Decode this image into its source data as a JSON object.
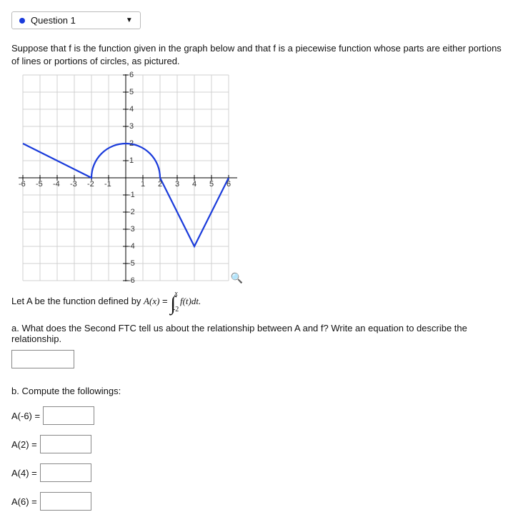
{
  "selector": {
    "label": "Question 1"
  },
  "prompt": "Suppose that f is the function given in the graph below and that f is a piecewise function whose parts are either portions of lines or portions of circles, as pictured.",
  "graph": {
    "x_ticks": [
      "-6",
      "-5",
      "-4",
      "-3",
      "-2",
      "-1",
      "1",
      "2",
      "3",
      "4",
      "5",
      "6"
    ],
    "y_ticks_pos": [
      "1",
      "2",
      "3",
      "4",
      "5",
      "6"
    ],
    "y_ticks_neg": [
      "-1",
      "-2",
      "-3",
      "-4",
      "-5",
      "-6"
    ]
  },
  "definition": {
    "lead": "Let A be the function defined by ",
    "fn": "A(x)",
    "eq": " = ",
    "lower": "-2",
    "upper": "x",
    "integrand": "f(t)dt."
  },
  "parts": {
    "a": "a. What does the Second FTC tell us about the relationship between A and f? Write an equation to describe the relationship.",
    "b": "b. Compute the followings:",
    "rows": [
      {
        "label": "A(-6) ="
      },
      {
        "label": "A(2) ="
      },
      {
        "label": "A(4) ="
      },
      {
        "label": "A(6) ="
      }
    ]
  },
  "chart_data": {
    "type": "line",
    "title": "",
    "xlabel": "",
    "ylabel": "",
    "xlim": [
      -6,
      6
    ],
    "ylim": [
      -6,
      6
    ],
    "grid": true,
    "series": [
      {
        "name": "f",
        "segments": [
          {
            "kind": "line",
            "from": [
              -6,
              2
            ],
            "to": [
              -2,
              0
            ]
          },
          {
            "kind": "semicircle_upper",
            "center": [
              0,
              0
            ],
            "radius": 2,
            "from_x": -2,
            "to_x": 2
          },
          {
            "kind": "line",
            "from": [
              2,
              0
            ],
            "to": [
              4,
              -4
            ]
          },
          {
            "kind": "line",
            "from": [
              4,
              -4
            ],
            "to": [
              6,
              0
            ]
          }
        ]
      }
    ]
  }
}
